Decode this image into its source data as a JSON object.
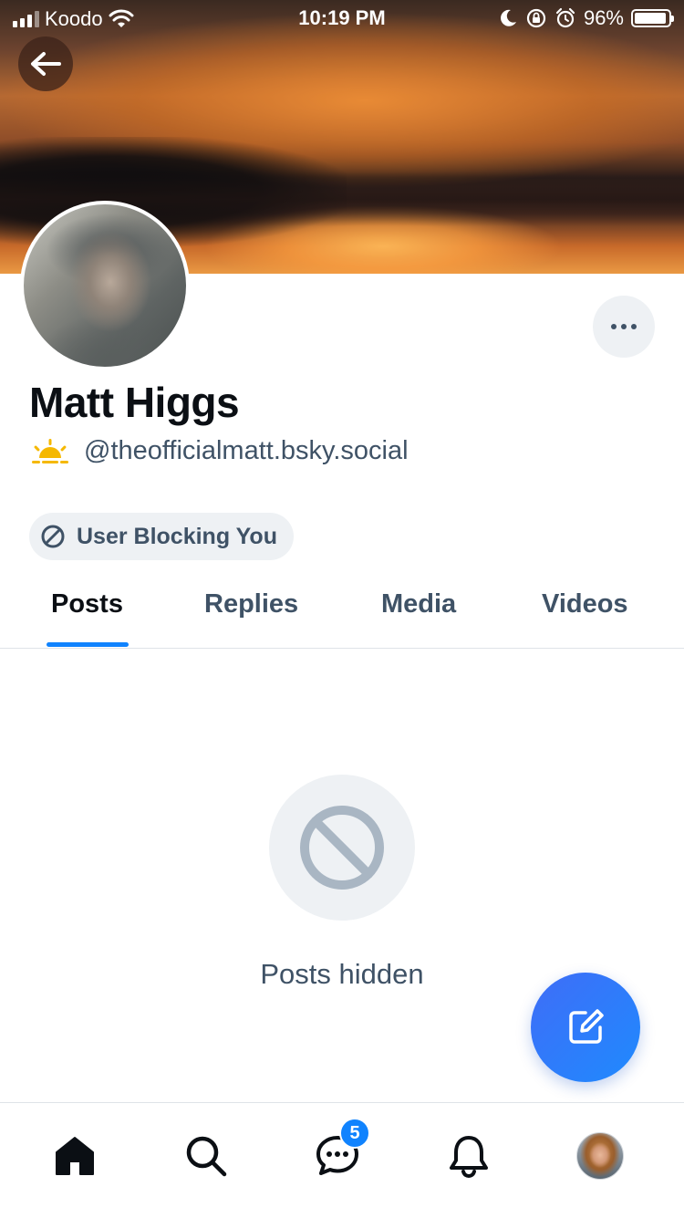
{
  "status_bar": {
    "carrier": "Koodo",
    "time": "10:19 PM",
    "battery": "96%",
    "battery_level": 0.96,
    "icons": [
      "signal-icon",
      "wifi-icon",
      "moon-icon",
      "orientation-lock-icon",
      "alarm-icon",
      "battery-icon"
    ]
  },
  "profile": {
    "display_name": "Matt Higgs",
    "handle": "@theofficialmatt.bsky.social",
    "handle_icon": "sunrise-icon",
    "blocking_label": "User Blocking You"
  },
  "tabs": [
    {
      "label": "Posts",
      "active": true
    },
    {
      "label": "Replies",
      "active": false
    },
    {
      "label": "Media",
      "active": false
    },
    {
      "label": "Videos",
      "active": false
    }
  ],
  "empty_state": {
    "icon": "block-icon",
    "message": "Posts hidden"
  },
  "bottom_nav": {
    "items": [
      "home-icon",
      "search-icon",
      "chat-icon",
      "bell-icon",
      "profile-avatar"
    ],
    "chat_badge": "5"
  },
  "colors": {
    "accent": "#1083fe",
    "text_primary": "#0b0f14",
    "text_secondary": "#3f5266",
    "pill_bg": "#eef1f4",
    "sun": "#f5b800"
  }
}
